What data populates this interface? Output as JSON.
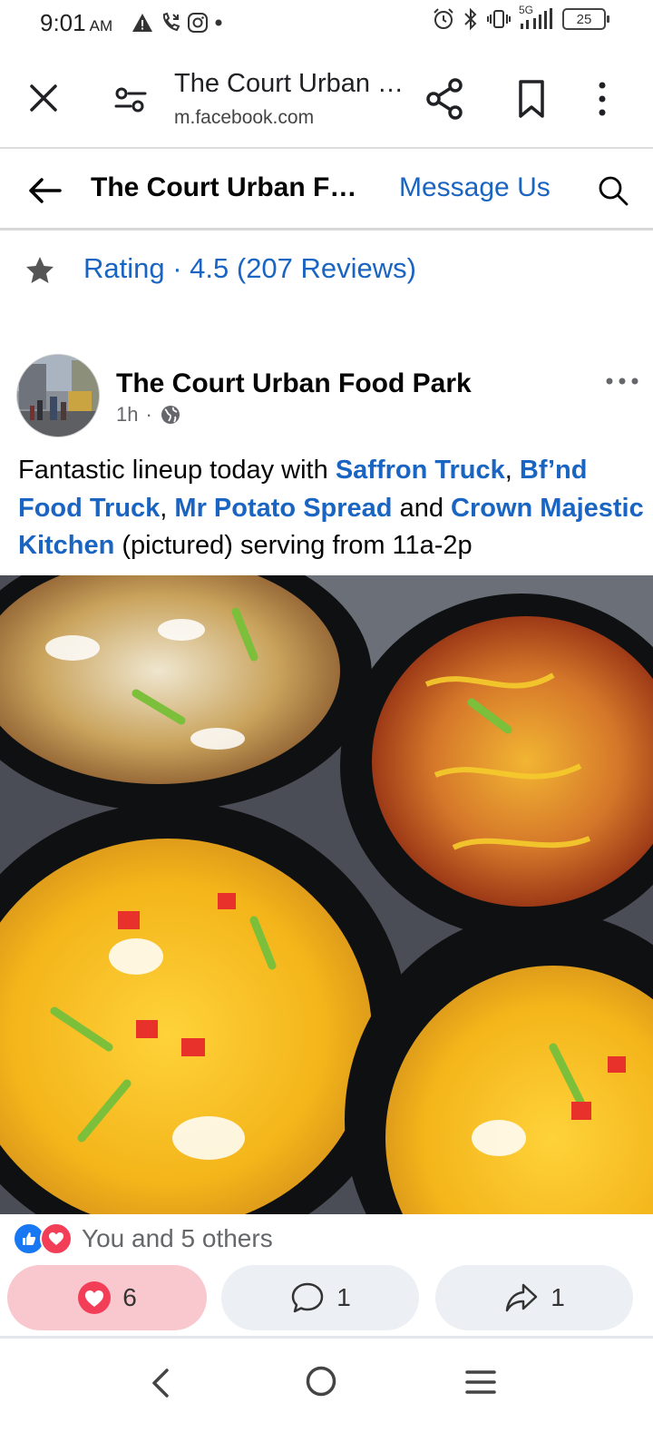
{
  "status_bar": {
    "time": "9:01",
    "am_pm": "AM",
    "network": "5G",
    "battery": "25"
  },
  "browser": {
    "title": "The Court Urban …",
    "url": "m.facebook.com"
  },
  "page_header": {
    "title": "The Court Urban F…",
    "message_label": "Message Us"
  },
  "rating": {
    "text": "Rating · 4.5 (207 Reviews)"
  },
  "post": {
    "author": "The Court Urban Food Park",
    "time": "1h",
    "meta_separator": "·",
    "text": {
      "intro": "Fantastic lineup today with ",
      "tag1": "Saffron Truck",
      "sep1": ", ",
      "tag2": "Bf’nd Food Truck",
      "sep2": ", ",
      "tag3": "Mr Potato Spread",
      "sep3": " and ",
      "tag4": "Crown Majestic Kitchen",
      "outro": " (pictured) serving from 11a-2p"
    },
    "reactions_text": "You and 5 others",
    "react_count": "6",
    "comment_count": "1",
    "share_count": "1"
  },
  "colors": {
    "link_blue": "#1a64c2",
    "like_blue": "#1877f2",
    "love_red": "#f33e58",
    "react_bg": "#f9c8cf",
    "button_bg": "#eceff3"
  },
  "icons": {
    "close": "close-icon",
    "tune": "tune-icon",
    "share": "share-icon",
    "bookmark": "bookmark-icon",
    "more": "more-vertical-icon",
    "back": "arrow-left-icon",
    "search": "search-icon",
    "star": "star-icon",
    "globe": "globe-icon",
    "comment": "comment-icon",
    "forward": "share-arrow-icon"
  }
}
